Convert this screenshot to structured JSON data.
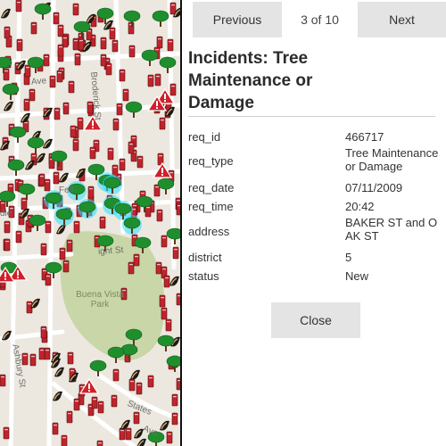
{
  "map": {
    "street_labels": [
      "Fell",
      "Ave",
      "ight St",
      "Broderick St",
      "dle",
      "Ashbury St",
      "States",
      "Ave"
    ],
    "park_label_line1": "Buena Vista",
    "park_label_line2": "Park",
    "marker_icons": [
      "tree-icon",
      "fire-hydrant-icon",
      "broom-icon",
      "warning-icon"
    ],
    "colors": {
      "land": "#ece8e0",
      "park": "#c9d6a8",
      "road": "#ffffff",
      "tree": "#1f8f2e",
      "hydrant": "#c0242c",
      "selection": "#2be0ff",
      "warning": "#d0202a"
    }
  },
  "popup": {
    "prev_label": "Previous",
    "next_label": "Next",
    "pager": "3 of 10",
    "title": "Incidents: Tree Maintenance or Damage",
    "attributes": [
      {
        "key": "req_id",
        "value": "466717"
      },
      {
        "key": "req_type",
        "value": "Tree Maintenance or Damage"
      },
      {
        "key": "req_date",
        "value": "07/11/2009"
      },
      {
        "key": "req_time",
        "value": "20:42"
      },
      {
        "key": "address",
        "value": "BAKER ST and OAK ST"
      },
      {
        "key": "district",
        "value": "5"
      },
      {
        "key": "status",
        "value": "New"
      }
    ],
    "close_label": "Close"
  }
}
